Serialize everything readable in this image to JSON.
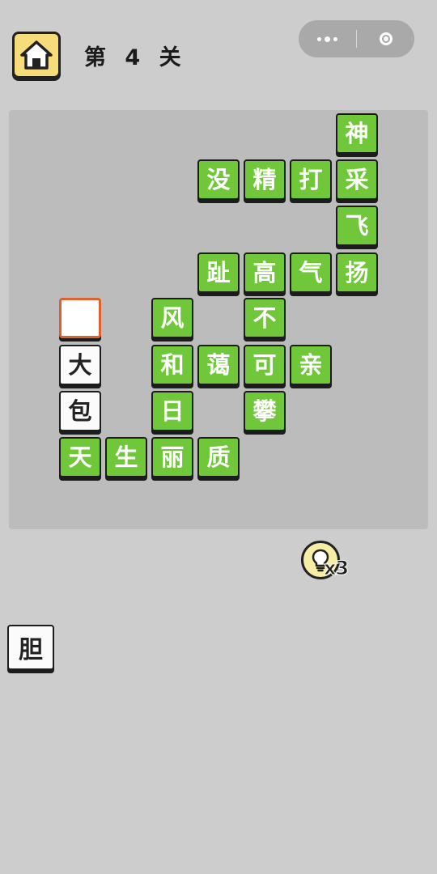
{
  "header": {
    "level_label": "第 4 关",
    "home_icon": "home-icon",
    "menu_icon": "more-dots-icon",
    "close_icon": "target-circle-icon"
  },
  "colors": {
    "background": "#cdcdcd",
    "board": "#bcbcbc",
    "tile_green": "#71c73a",
    "tile_white": "#fbfbfb",
    "selected_border": "#e0602e",
    "home_button": "#f7dc7c",
    "hint_bulb": "#f6eea4"
  },
  "grid": {
    "tiles": [
      {
        "row": 0,
        "col": 7,
        "char": "神",
        "state": "solved"
      },
      {
        "row": 1,
        "col": 4,
        "char": "没",
        "state": "solved"
      },
      {
        "row": 1,
        "col": 5,
        "char": "精",
        "state": "solved"
      },
      {
        "row": 1,
        "col": 6,
        "char": "打",
        "state": "solved"
      },
      {
        "row": 1,
        "col": 7,
        "char": "采",
        "state": "solved"
      },
      {
        "row": 2,
        "col": 7,
        "char": "飞",
        "state": "solved"
      },
      {
        "row": 3,
        "col": 4,
        "char": "趾",
        "state": "solved"
      },
      {
        "row": 3,
        "col": 5,
        "char": "高",
        "state": "solved"
      },
      {
        "row": 3,
        "col": 6,
        "char": "气",
        "state": "solved"
      },
      {
        "row": 3,
        "col": 7,
        "char": "扬",
        "state": "solved"
      },
      {
        "row": 4,
        "col": 1,
        "char": "",
        "state": "selected-empty"
      },
      {
        "row": 4,
        "col": 3,
        "char": "风",
        "state": "solved"
      },
      {
        "row": 4,
        "col": 5,
        "char": "不",
        "state": "solved"
      },
      {
        "row": 5,
        "col": 1,
        "char": "大",
        "state": "given"
      },
      {
        "row": 5,
        "col": 3,
        "char": "和",
        "state": "solved"
      },
      {
        "row": 5,
        "col": 4,
        "char": "蔼",
        "state": "solved"
      },
      {
        "row": 5,
        "col": 5,
        "char": "可",
        "state": "solved"
      },
      {
        "row": 5,
        "col": 6,
        "char": "亲",
        "state": "solved"
      },
      {
        "row": 6,
        "col": 1,
        "char": "包",
        "state": "given"
      },
      {
        "row": 6,
        "col": 3,
        "char": "日",
        "state": "solved"
      },
      {
        "row": 6,
        "col": 5,
        "char": "攀",
        "state": "solved"
      },
      {
        "row": 7,
        "col": 1,
        "char": "天",
        "state": "solved"
      },
      {
        "row": 7,
        "col": 2,
        "char": "生",
        "state": "solved"
      },
      {
        "row": 7,
        "col": 3,
        "char": "丽",
        "state": "solved"
      },
      {
        "row": 7,
        "col": 4,
        "char": "质",
        "state": "solved"
      }
    ]
  },
  "hint": {
    "icon": "lightbulb-icon",
    "count_label": "x3"
  },
  "candidates": [
    {
      "char": "胆"
    }
  ]
}
